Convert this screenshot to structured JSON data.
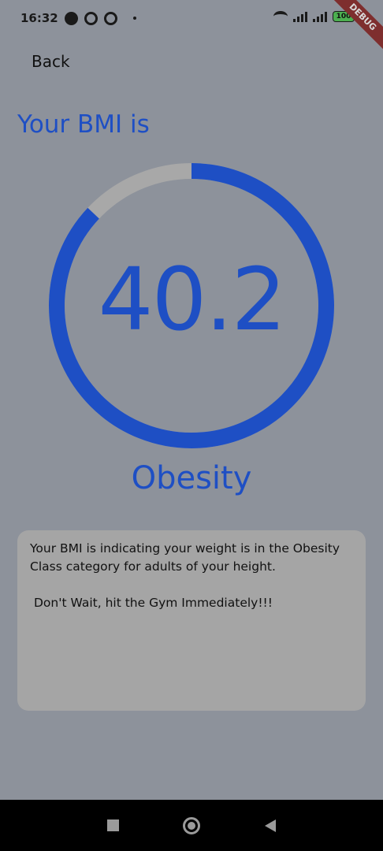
{
  "status": {
    "time": "16:32",
    "battery": "100"
  },
  "debug_banner": "DEBUG",
  "back_label": "Back",
  "title": "Your BMI is",
  "gauge": {
    "value": "40.2",
    "fill_fraction": 0.87,
    "track_color": "#a8a8a8",
    "fill_color": "#1e4fc4"
  },
  "category": "Obesity",
  "card": {
    "description": "Your BMI is indicating your weight is in the Obesity Class category for adults of your height.",
    "advice": "Don't Wait, hit the Gym Immediately!!!"
  },
  "colors": {
    "accent": "#1e4fc4",
    "background": "#8d929b",
    "card": "#a5a5a5"
  }
}
